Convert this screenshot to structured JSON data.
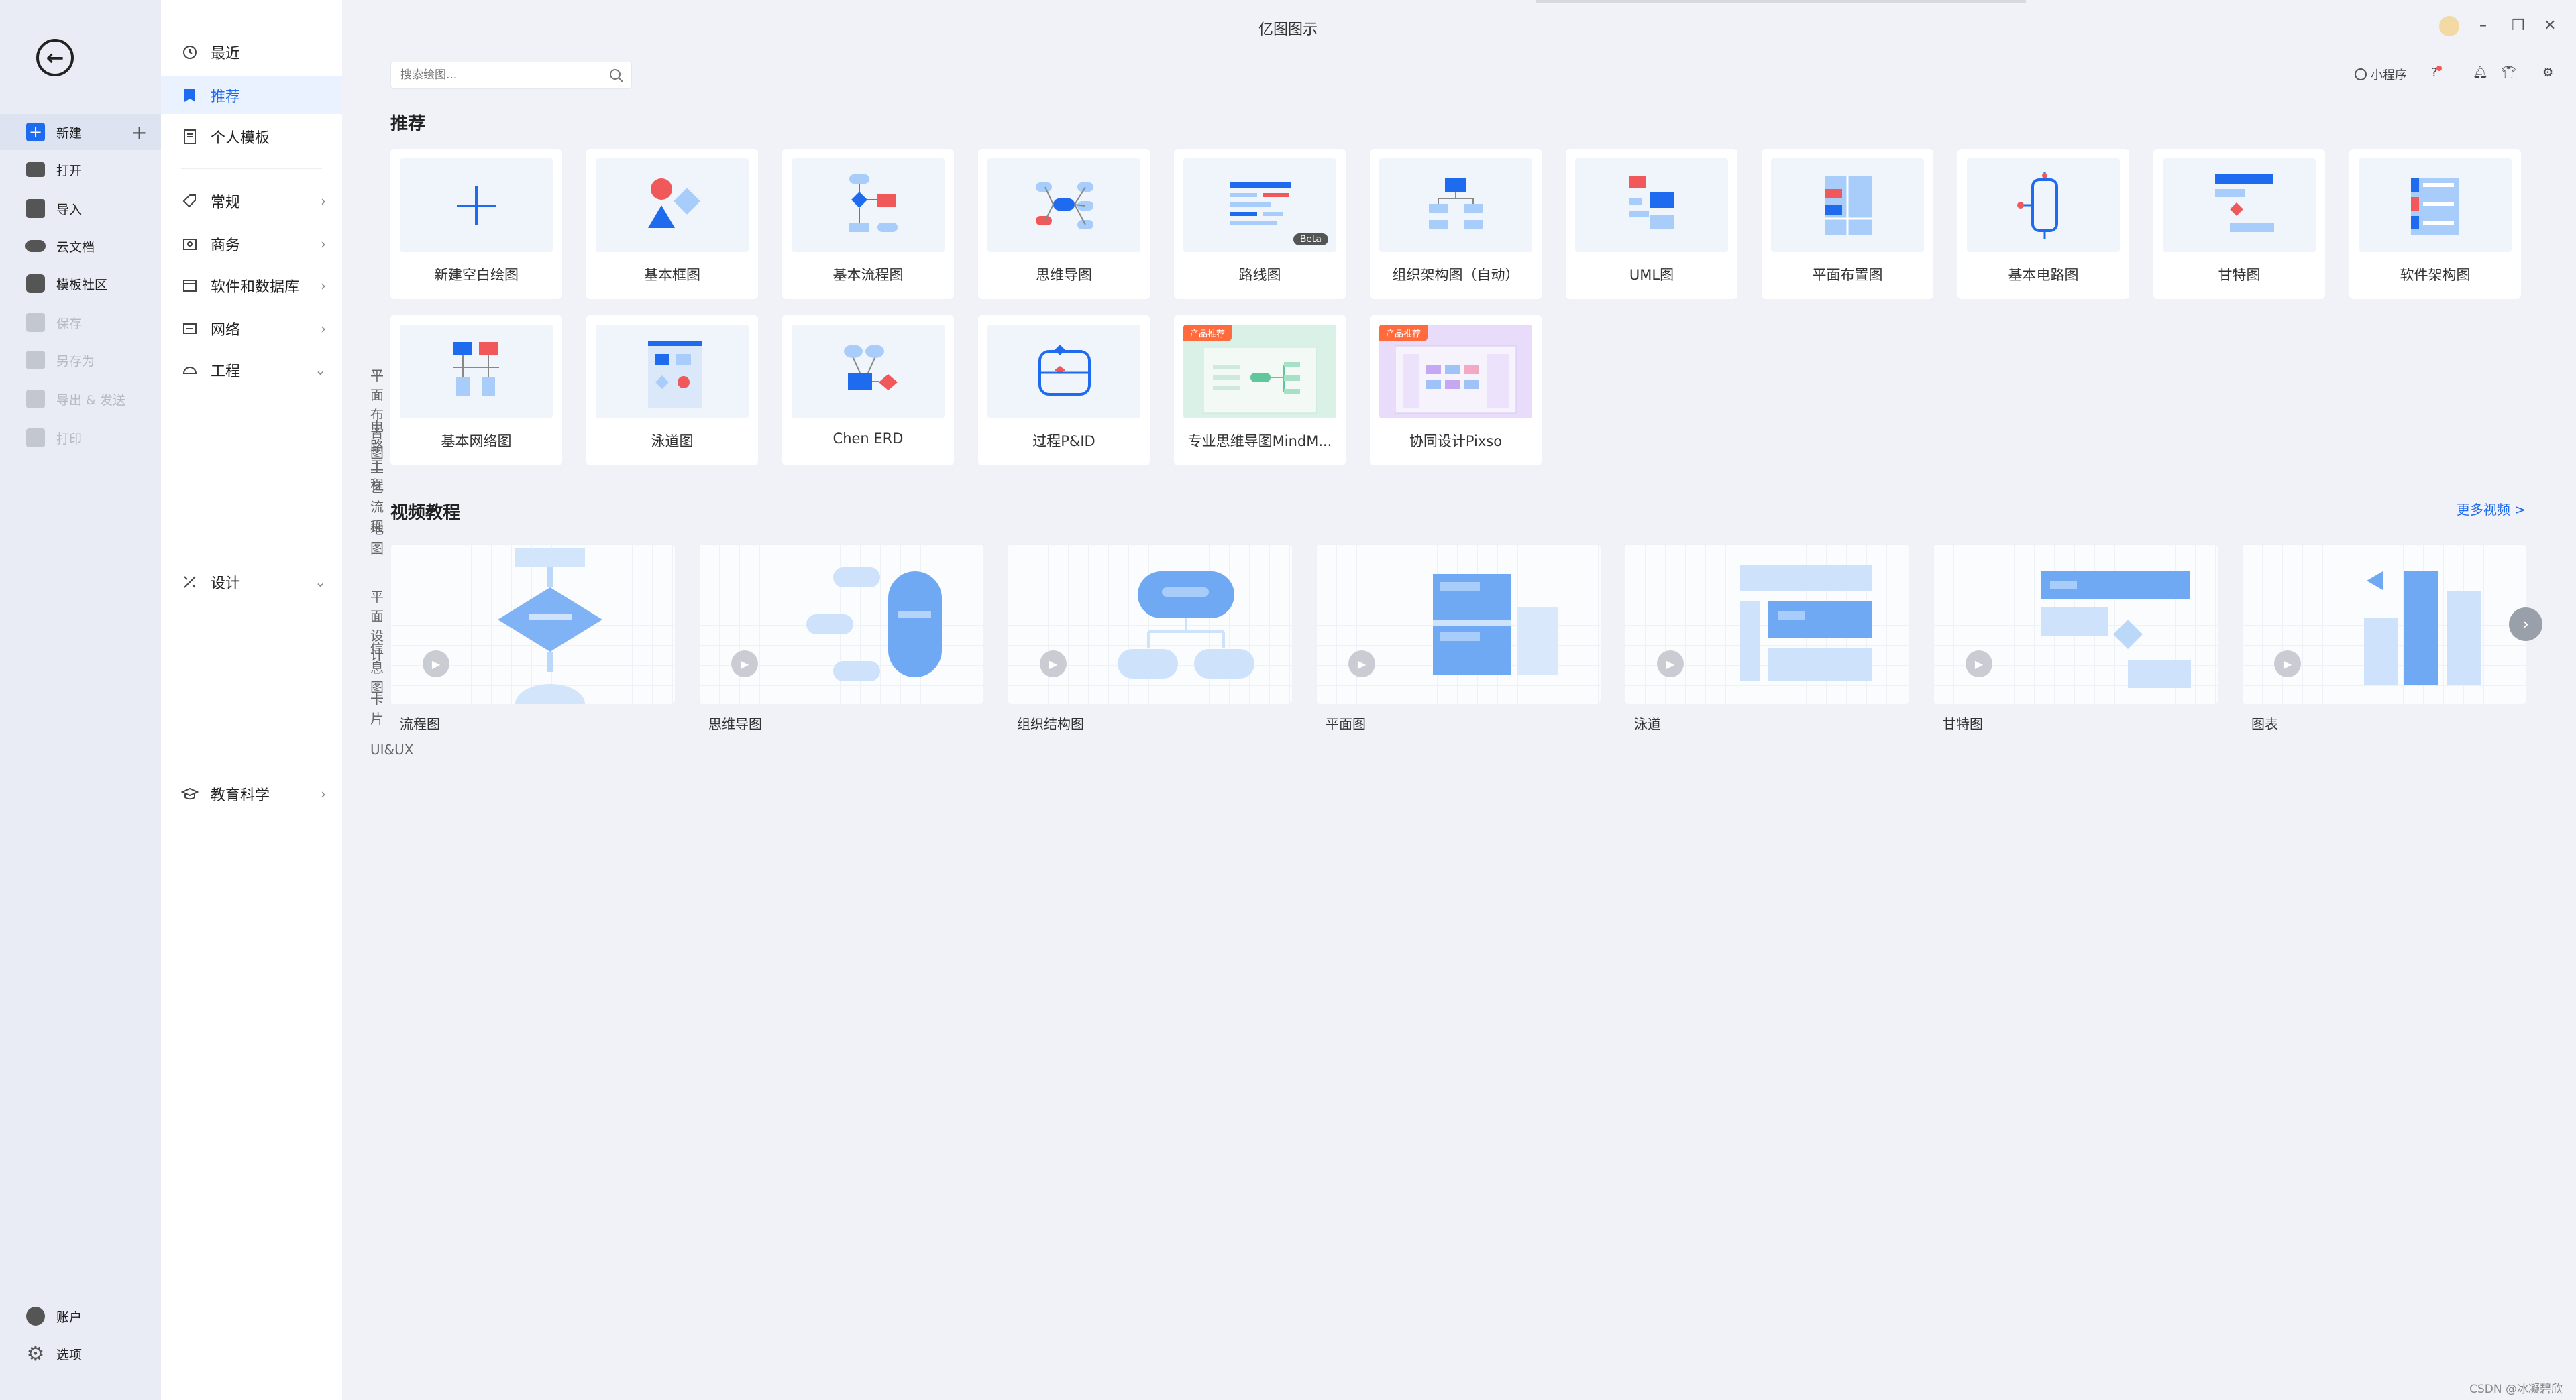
{
  "window": {
    "title": "亿图图示"
  },
  "rail": {
    "items": [
      {
        "label": "新建",
        "icon": "new-icon"
      },
      {
        "label": "打开",
        "icon": "folder-icon"
      },
      {
        "label": "导入",
        "icon": "import-icon"
      },
      {
        "label": "云文档",
        "icon": "cloud-icon"
      },
      {
        "label": "模板社区",
        "icon": "community-icon"
      },
      {
        "label": "保存",
        "icon": "save-icon"
      },
      {
        "label": "另存为",
        "icon": "save-as-icon"
      },
      {
        "label": "导出 & 发送",
        "icon": "export-icon"
      },
      {
        "label": "打印",
        "icon": "print-icon"
      }
    ],
    "bottom": [
      {
        "label": "账户",
        "icon": "account-icon"
      },
      {
        "label": "选项",
        "icon": "gear-icon"
      }
    ]
  },
  "categories": {
    "top": [
      "最近",
      "推荐",
      "个人模板"
    ],
    "groups": [
      "常规",
      "商务",
      "软件和数据库",
      "网络",
      "工程"
    ],
    "engineering_subs": [
      "平面布置图",
      "电路工程",
      "工艺流程",
      "地图"
    ],
    "design": "设计",
    "design_subs": [
      "平面设计",
      "信息图",
      "卡片",
      "UI&UX"
    ],
    "education": "教育科学"
  },
  "header": {
    "search_placeholder": "搜索绘图...",
    "mini_program": "小程序"
  },
  "recommend": {
    "title": "推荐",
    "cards": [
      "新建空白绘图",
      "基本框图",
      "基本流程图",
      "思维导图",
      "路线图",
      "组织架构图（自动）",
      "UML图",
      "平面布置图",
      "基本电路图",
      "甘特图",
      "软件架构图",
      "基本网络图",
      "泳道图",
      "Chen ERD",
      "过程P&ID",
      "专业思维导图MindM...",
      "协同设计Pixso"
    ],
    "beta_badge": "Beta",
    "promo_badge": "产品推荐"
  },
  "videos": {
    "title": "视频教程",
    "more": "更多视频 >",
    "items": [
      "流程图",
      "思维导图",
      "组织结构图",
      "平面图",
      "泳道",
      "甘特图",
      "图表"
    ]
  },
  "watermark": "CSDN @冰凝碧欣",
  "colors": {
    "accent": "#1f6bf0",
    "red": "#f0585a",
    "light_blue": "#a9cdfa"
  }
}
